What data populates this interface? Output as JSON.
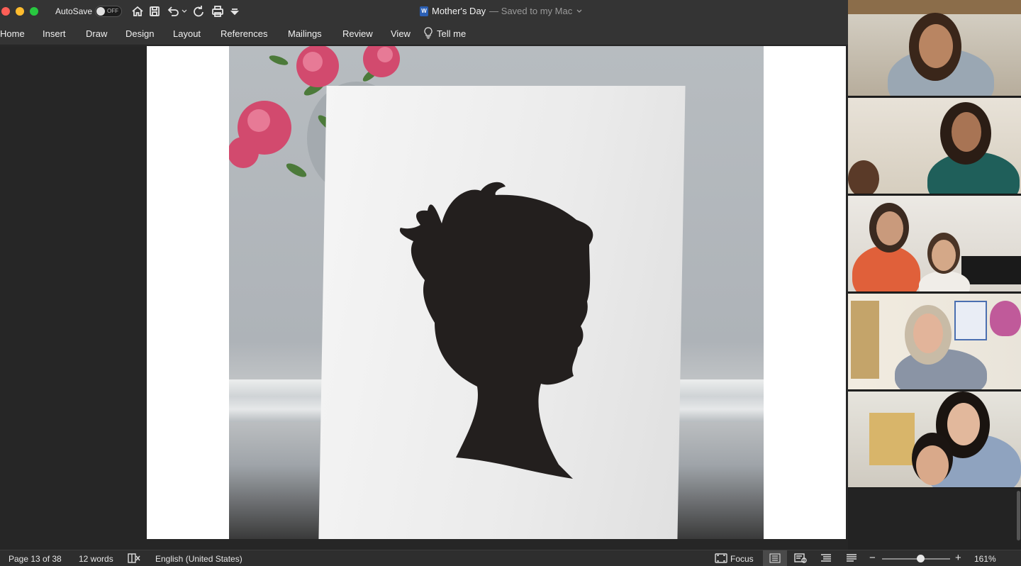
{
  "app": {
    "autosave_label": "AutoSave",
    "autosave_state": "OFF",
    "doc_name": "Mother's Day",
    "doc_status": "— Saved to my Mac",
    "word_badge": "W"
  },
  "ribbon": {
    "tabs": [
      "Home",
      "Insert",
      "Draw",
      "Design",
      "Layout",
      "References",
      "Mailings",
      "Review",
      "View"
    ],
    "tell_me": "Tell me"
  },
  "status": {
    "page": "Page 13 of 38",
    "words": "12 words",
    "language": "English (United States)",
    "focus": "Focus",
    "zoom": "161%",
    "zoom_slider_fraction": 0.57
  },
  "icons": {
    "home": "home-icon",
    "save": "save-icon",
    "undo": "undo-icon",
    "redo": "redo-icon",
    "print": "print-icon",
    "customize": "customize-toolbar-icon",
    "lightbulb": "lightbulb-icon",
    "proofing": "proofing-icon",
    "focus": "focus-icon"
  },
  "colors": {
    "traffic_red": "#fe5f57",
    "traffic_yellow": "#febc2e",
    "traffic_green": "#28c840",
    "word_blue": "#2b5fb4"
  }
}
